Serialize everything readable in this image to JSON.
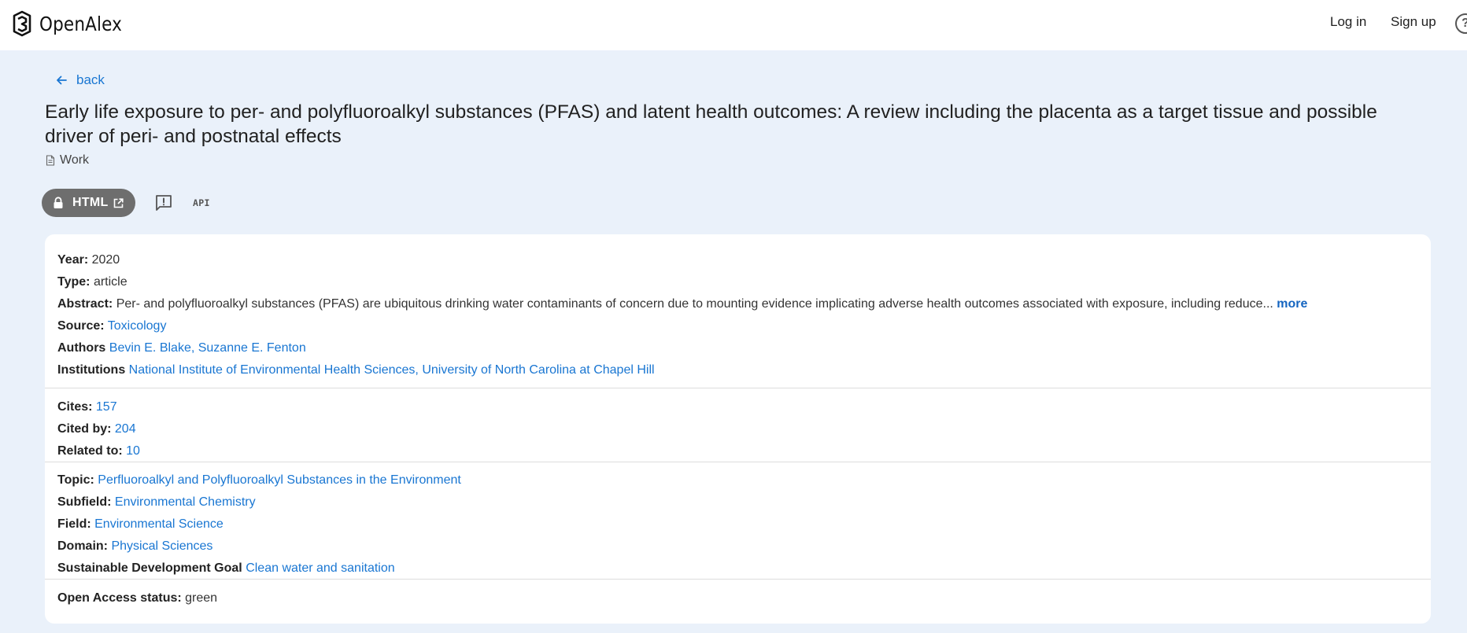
{
  "app": {
    "name": "OpenAlex"
  },
  "nav": {
    "login": "Log in",
    "signup": "Sign up",
    "help_icon": "help-circle-icon"
  },
  "header": {
    "back_label": "back",
    "title": "Early life exposure to per- and polyfluoroalkyl substances (PFAS) and latent health outcomes: A review including the placenta as a target tissue and possible driver of peri- and postnatal effects",
    "entity_type": "Work"
  },
  "actions": {
    "html_label": "HTML",
    "comment_icon": "comment-alert-icon",
    "api_label": "API"
  },
  "details": {
    "year": {
      "label": "Year:",
      "value": "2020"
    },
    "type": {
      "label": "Type:",
      "value": "article"
    },
    "abstract": {
      "label": "Abstract:",
      "value": "Per- and polyfluoroalkyl substances (PFAS) are ubiquitous drinking water contaminants of concern due to mounting evidence implicating adverse health outcomes associated with exposure, including reduce...",
      "more": "more"
    },
    "source": {
      "label": "Source:",
      "value": "Toxicology"
    },
    "authors": {
      "label": "Authors",
      "items": [
        "Bevin E. Blake,",
        "Suzanne E. Fenton"
      ]
    },
    "institutions": {
      "label": "Institutions",
      "items": [
        "National Institute of Environmental Health Sciences,",
        "University of North Carolina at Chapel Hill"
      ]
    }
  },
  "counts": {
    "cites": {
      "label": "Cites:",
      "value": "157"
    },
    "cited_by": {
      "label": "Cited by:",
      "value": "204"
    },
    "related_to": {
      "label": "Related to:",
      "value": "10"
    }
  },
  "topics": {
    "topic": {
      "label": "Topic:",
      "value": "Perfluoroalkyl and Polyfluoroalkyl Substances in the Environment"
    },
    "subfield": {
      "label": "Subfield:",
      "value": "Environmental Chemistry"
    },
    "field": {
      "label": "Field:",
      "value": "Environmental Science"
    },
    "domain": {
      "label": "Domain:",
      "value": "Physical Sciences"
    },
    "sdg": {
      "label": "Sustainable Development Goal",
      "value": "Clean water and sanitation"
    }
  },
  "open_access": {
    "label": "Open Access status:",
    "value": "green"
  },
  "colors": {
    "background": "#eaf1fa",
    "link": "#1976d2",
    "chip": "#6e6e6e"
  }
}
